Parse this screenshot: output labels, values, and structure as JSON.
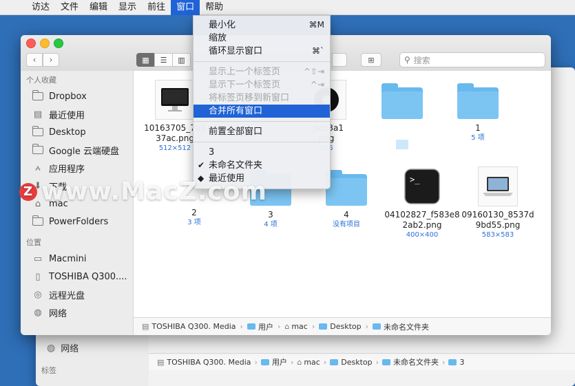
{
  "menubar": {
    "items": [
      "访达",
      "文件",
      "编辑",
      "显示",
      "前往",
      "窗口",
      "帮助"
    ],
    "active_index": 5
  },
  "window_menu": {
    "minimize": "最小化",
    "minimize_shortcut": "⌘M",
    "zoom": "缩放",
    "cycle": "循环显示窗口",
    "cycle_shortcut": "⌘`",
    "prev_tab": "显示上一个标签页",
    "prev_tab_shortcut": "^⇧⇥",
    "next_tab": "显示下一个标签页",
    "next_tab_shortcut": "^⇥",
    "move_tab": "将标签页移到新窗口",
    "merge": "合并所有窗口",
    "bring_all": "前置全部窗口",
    "win1": "3",
    "win2": "未命名文件夹",
    "win3": "最近使用"
  },
  "toolbar": {
    "search_placeholder": "搜索"
  },
  "sidebar": {
    "favorites_header": "个人收藏",
    "favorites": [
      "Dropbox",
      "最近使用",
      "Desktop",
      "Google 云端硬盘",
      "应用程序",
      "下载",
      "mac",
      "PowerFolders"
    ],
    "locations_header": "位置",
    "locations": [
      "Macmini",
      "TOSHIBA Q300....",
      "远程光盘",
      "网络"
    ]
  },
  "files": [
    {
      "name": "10163705_7a6",
      "name2": "37ac.png",
      "sub": "512×512"
    },
    {
      "name": "",
      "name2": "",
      "sub": ""
    },
    {
      "name": "_aec3a1",
      "name2": "png",
      "sub": "256"
    },
    {
      "name": "",
      "name2": "",
      "sub": ""
    },
    {
      "name": "1",
      "name2": "",
      "sub": "5 项"
    },
    {
      "name": "2",
      "name2": "",
      "sub": "3 项"
    },
    {
      "name": "3",
      "name2": "",
      "sub": "4 项"
    },
    {
      "name": "4",
      "name2": "",
      "sub": "没有项目"
    },
    {
      "name": "04102827_f583e8",
      "name2": "2ab2.png",
      "sub": "400×400"
    },
    {
      "name": "09160130_8537d",
      "name2": "9bd55.png",
      "sub": "583×583"
    }
  ],
  "pathbar": [
    "TOSHIBA Q300. Media",
    "用户",
    "mac",
    "Desktop",
    "未命名文件夹"
  ],
  "back_window": {
    "network": "网络",
    "tags": "标签",
    "path": [
      "TOSHIBA Q300. Media",
      "用户",
      "mac",
      "Desktop",
      "未命名文件夹",
      "3"
    ]
  },
  "watermark": "www.MacZ.com"
}
